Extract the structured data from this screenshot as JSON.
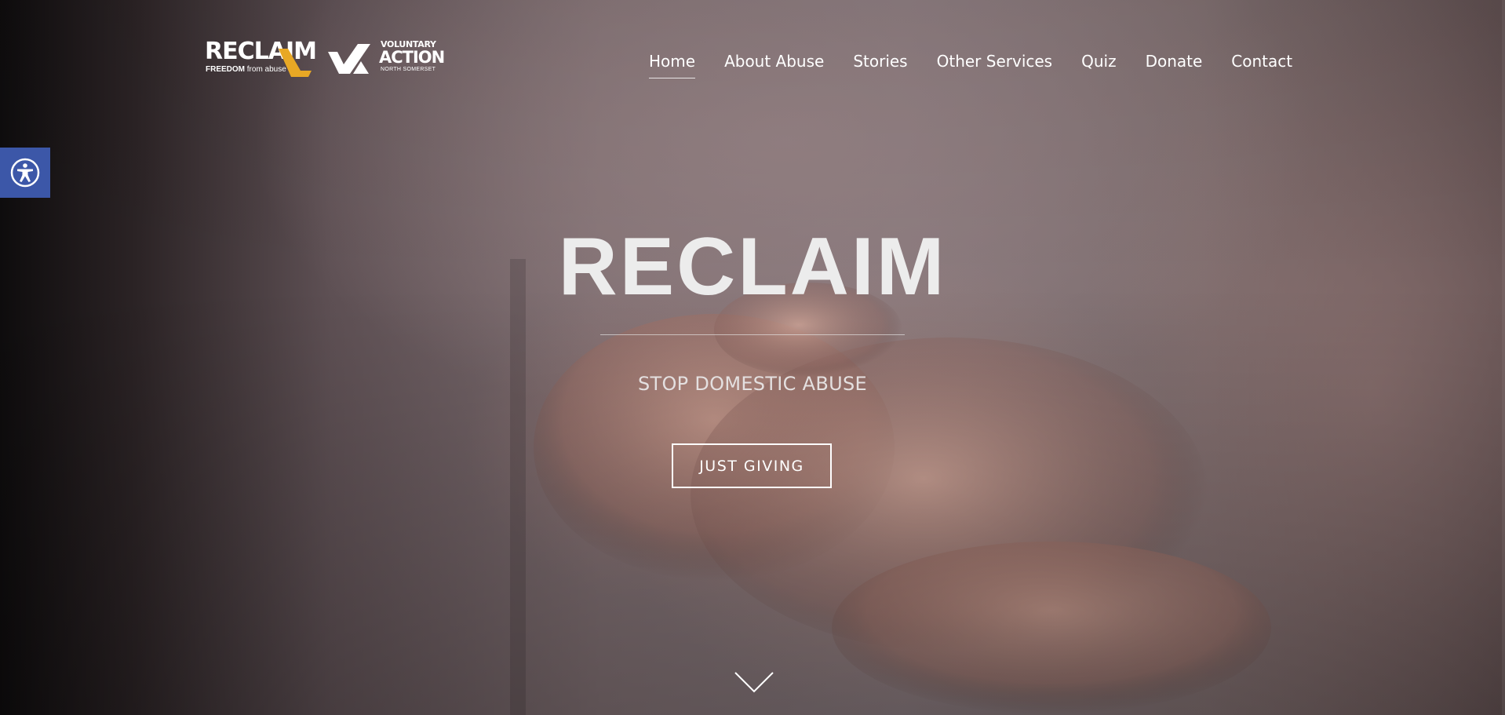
{
  "logos": {
    "reclaim_word": "RECLAIM",
    "reclaim_tagline_bold": "FREEDOM",
    "reclaim_tagline_light": "from abuse",
    "va_line1": "VOLUNTARY",
    "va_line2": "ACTION",
    "va_line3": "NORTH SOMERSET",
    "accent_color": "#e8a825"
  },
  "nav": {
    "items": [
      {
        "label": "Home",
        "active": true
      },
      {
        "label": "About Abuse",
        "active": false
      },
      {
        "label": "Stories",
        "active": false
      },
      {
        "label": "Other Services",
        "active": false
      },
      {
        "label": "Quiz",
        "active": false
      },
      {
        "label": "Donate",
        "active": false
      },
      {
        "label": "Contact",
        "active": false
      }
    ]
  },
  "accessibility": {
    "icon": "accessibility-icon",
    "color": "#3c57a8"
  },
  "hero": {
    "title": "RECLAIM",
    "subtitle": "STOP DOMESTIC ABUSE",
    "cta_label": "JUST GIVING",
    "scroll_icon": "chevron-down-icon"
  }
}
